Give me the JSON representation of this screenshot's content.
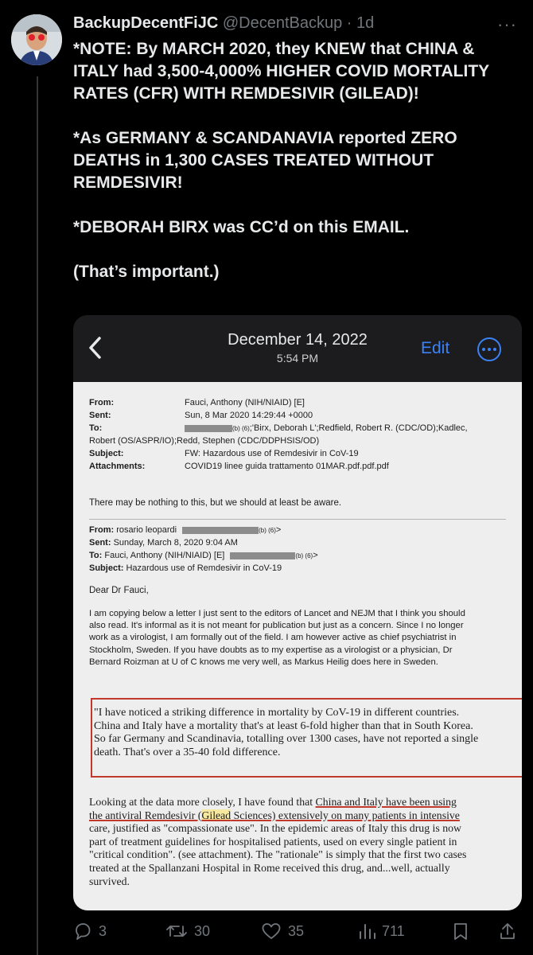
{
  "tweet": {
    "author_name": "BackupDecentFiJC",
    "author_handle": "@DecentBackup",
    "separator": " · ",
    "time": "1d",
    "more": "···",
    "text": [
      "*NOTE: By MARCH 2020, they KNEW that CHINA & ITALY had 3,500-4,000% HIGHER COVID MORTALITY RATES (CFR) WITH REMDESIVIR (GILEAD)!",
      "*As GERMANY & SCANDANAVIA reported ZERO DEATHS in 1,300 CASES TREATED WITHOUT REMDESIVIR!",
      "*DEBORAH BIRX was CC’d on this EMAIL.",
      "(That’s important.)"
    ]
  },
  "media": {
    "date": "December 14, 2022",
    "time": "5:54 PM",
    "edit_label": "Edit",
    "email": {
      "from_label": "From:",
      "from": "Fauci, Anthony (NIH/NIAID) [E]",
      "sent_label": "Sent:",
      "sent": "Sun, 8 Mar 2020 14:29:44 +0000",
      "to_label": "To:",
      "to_redaction": "(b) (6)",
      "to_line1": ";'Birx, Deborah L';Redfield, Robert R. (CDC/OD);Kadlec,",
      "to_line2": "Robert (OS/ASPR/IO);Redd, Stephen (CDC/DDPHSIS/OD)",
      "subject_label": "Subject:",
      "subject": "FW: Hazardous use of Remdesivir in CoV-19",
      "attachments_label": "Attachments:",
      "attachments": "COVID19 linee guida trattamento 01MAR.pdf.pdf.pdf",
      "note": "There may be nothing to this, but we should at least be aware.",
      "fw_from_label": "From:",
      "fw_from": "rosario leopardi",
      "fw_from_redaction": "(b) (6)",
      "fw_sent_label": "Sent:",
      "fw_sent": "Sunday, March 8, 2020 9:04 AM",
      "fw_to_label": "To:",
      "fw_to": "Fauci, Anthony (NIH/NIAID) [E]",
      "fw_to_redaction": "(b) (6)",
      "fw_subject_label": "Subject:",
      "fw_subject": "Hazardous use of Remdesivir in CoV-19",
      "greeting": "Dear Dr Fauci,",
      "body_lines": [
        "I am copying below a letter I just sent to the editors of Lancet and NEJM that I think you should",
        "also read. It's informal as it is not meant for publication but just as a concern. Since I no longer",
        "work as a virologist, I am formally out of the field. I am however active as chief psychiatrist in",
        "Stockholm, Sweden. If you have doubts as to my expertise as a virologist or a physician, Dr",
        "Bernard Roizman at U of C knows me very well, as Markus Heilig does here in Sweden."
      ],
      "quote_lines": [
        "\"I have noticed a striking difference in mortality by CoV-19 in different countries.",
        "China and Italy have a mortality that's at least 6-fold higher than that in South Korea.",
        "So far Germany and Scandinavia, totalling over 1300 cases, have not reported a single",
        "death. That's over a 35-40 fold difference."
      ],
      "closing": {
        "l1a": "Looking at the data more closely, I have found that ",
        "l1b": "China and Italy have been using",
        "l2a": "the antiviral Remdesivir (",
        "l2b": "Gilead",
        "l2c": " Sciences) extensively on many patients in intensive",
        "l3": "care, justified as \"compassionate use\". In the epidemic areas of Italy this drug is now",
        "l4": "part of treatment guidelines for hospitalised patients, used on every single patient in",
        "l5": "\"critical condition\". (see attachment). The \"rationale\" is simply that the first two cases",
        "l6": "treated at the Spallanzani Hospital in Rome received this drug, and...well, actually",
        "l7": "survived."
      }
    }
  },
  "actions": {
    "replies": "3",
    "retweets": "30",
    "likes": "35",
    "views": "711"
  },
  "colors": {
    "accent": "#3b82f6",
    "muted": "#71767b",
    "highlight_red": "#c0392b"
  }
}
